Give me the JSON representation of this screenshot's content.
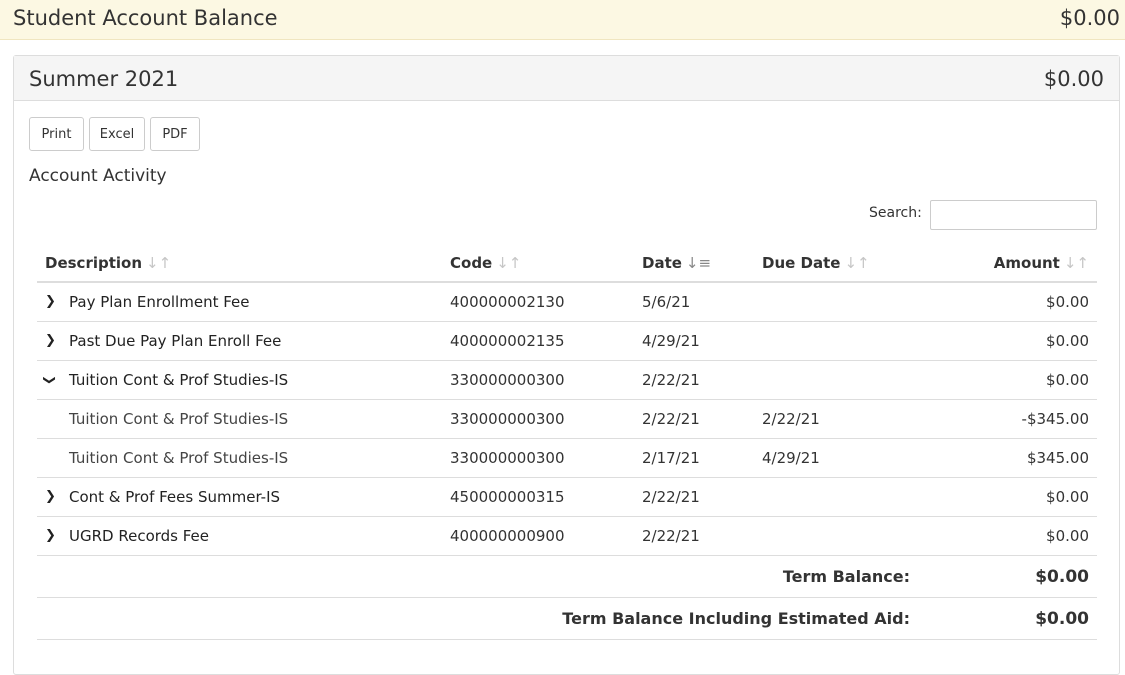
{
  "banner": {
    "title": "Student Account Balance",
    "amount": "$0.00"
  },
  "term": {
    "title": "Summer 2021",
    "amount": "$0.00"
  },
  "toolbar": {
    "print": "Print",
    "excel": "Excel",
    "pdf": "PDF"
  },
  "section_title": "Account Activity",
  "search": {
    "label": "Search:",
    "value": "",
    "placeholder": ""
  },
  "table": {
    "headers": {
      "description": "Description",
      "code": "Code",
      "date": "Date",
      "due_date": "Due Date",
      "amount": "Amount"
    },
    "sort_icons": {
      "default": "sort-icon",
      "active_column": "date",
      "active": "sort-descending-icon"
    },
    "rows": [
      {
        "expander": "chevron-right-icon",
        "description": "Pay Plan Enrollment Fee",
        "code": "400000002130",
        "date": "5/6/21",
        "due_date": "",
        "amount": "$0.00"
      },
      {
        "expander": "chevron-right-icon",
        "description": "Past Due Pay Plan Enroll Fee",
        "code": "400000002135",
        "date": "4/29/21",
        "due_date": "",
        "amount": "$0.00"
      },
      {
        "expander": "chevron-down-icon",
        "description": "Tuition Cont & Prof Studies-IS",
        "code": "330000000300",
        "date": "2/22/21",
        "due_date": "",
        "amount": "$0.00"
      },
      {
        "child": true,
        "description": "Tuition Cont & Prof Studies-IS",
        "code": "330000000300",
        "date": "2/22/21",
        "due_date": "2/22/21",
        "amount": "-$345.00"
      },
      {
        "child": true,
        "description": "Tuition Cont & Prof Studies-IS",
        "code": "330000000300",
        "date": "2/17/21",
        "due_date": "4/29/21",
        "amount": "$345.00"
      },
      {
        "expander": "chevron-right-icon",
        "description": "Cont & Prof Fees Summer-IS",
        "code": "450000000315",
        "date": "2/22/21",
        "due_date": "",
        "amount": "$0.00"
      },
      {
        "expander": "chevron-right-icon",
        "description": "UGRD Records Fee",
        "code": "400000000900",
        "date": "2/22/21",
        "due_date": "",
        "amount": "$0.00"
      }
    ],
    "totals": {
      "term_balance_label": "Term Balance:",
      "term_balance": "$0.00",
      "est_aid_label": "Term Balance Including Estimated Aid:",
      "est_aid_balance": "$0.00"
    }
  }
}
